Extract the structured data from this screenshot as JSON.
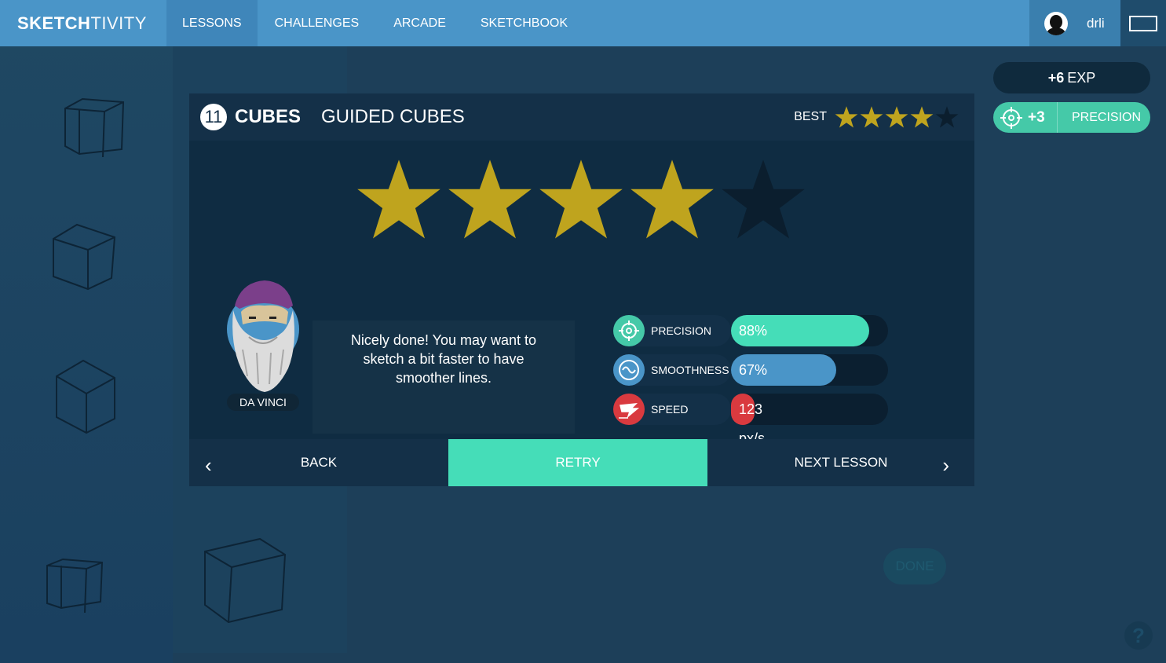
{
  "app": {
    "logo_bold": "SKETCH",
    "logo_light": "TIVITY"
  },
  "nav": {
    "items": [
      {
        "label": "LESSONS",
        "active": true
      },
      {
        "label": "CHALLENGES",
        "active": false
      },
      {
        "label": "ARCADE",
        "active": false
      },
      {
        "label": "SKETCHBOOK",
        "active": false
      }
    ]
  },
  "user": {
    "name": "drli",
    "avatar_icon": "user-avatar-icon",
    "window_icon": "window-toggle-icon"
  },
  "rewards": {
    "exp_amount": "+6",
    "exp_label": "EXP",
    "precision_gain": "+3",
    "precision_label": "PRECISION"
  },
  "lesson": {
    "number": "11",
    "category": "CUBES",
    "name": "GUIDED CUBES",
    "best_label": "BEST",
    "best_stars": 4,
    "stars_total": 5,
    "earned_stars": 4
  },
  "mentor": {
    "name": "DA VINCI",
    "message": "Nicely done! You may want to sketch a bit faster to have smoother lines."
  },
  "stats": [
    {
      "label": "PRECISION",
      "value": "88%",
      "fraction": 0.88,
      "color": "#45ddb8",
      "icon": "target-icon"
    },
    {
      "label": "SMOOTHNESS",
      "value": "67%",
      "fraction": 0.67,
      "color": "#4a95c8",
      "icon": "wave-icon"
    },
    {
      "label": "SPEED",
      "value": "123",
      "fraction": 0.15,
      "color": "#d93a3f",
      "icon": "speed-wing-icon"
    }
  ],
  "speed_unit": "px/s",
  "footer": {
    "back": "BACK",
    "retry": "RETRY",
    "next": "NEXT LESSON"
  },
  "background": {
    "done_label": "DONE",
    "help_label": "?"
  },
  "colors": {
    "star_gold": "#bfa41e",
    "star_empty": "#0b1e2e",
    "accent_green": "#45ddb8",
    "nav_blue": "#4a95c8"
  }
}
